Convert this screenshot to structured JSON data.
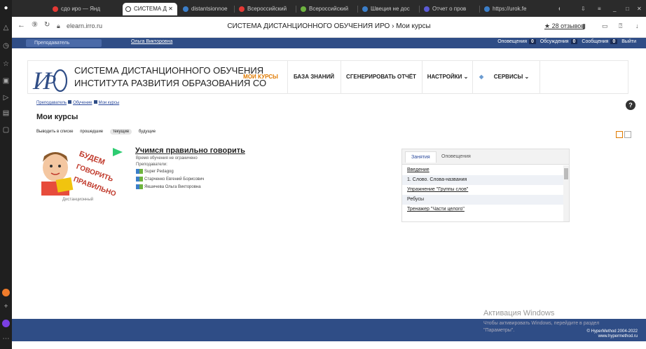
{
  "browser": {
    "tabs": [
      {
        "label": "сдо иро — Янд",
        "color": "#e53935"
      },
      {
        "label": "СИСТЕМА Д",
        "color": "#ffffff",
        "active": true
      },
      {
        "label": "distantsionnoe",
        "color": "#3b7ec9"
      },
      {
        "label": "Всероссийский",
        "color": "#e53935"
      },
      {
        "label": "Всероссийский",
        "color": "#6db33f"
      },
      {
        "label": "Швеция не дос",
        "color": "#3b7ec9"
      },
      {
        "label": "Отчет о пров",
        "color": "#5b5bd6"
      },
      {
        "label": "https://urok.fe",
        "color": "#3b7ec9"
      }
    ],
    "url": "elearn.irro.ru",
    "page_title": "СИСТЕМА ДИСТАНЦИОННОГО ОБУЧЕНИЯ ИРО › Мои курсы",
    "reviews": "★ 28 отзывов"
  },
  "topbar": {
    "role": "Преподаватель",
    "user": "Ольга Викторовна",
    "items": [
      {
        "label": "Оповещения",
        "count": "0"
      },
      {
        "label": "Обсуждения",
        "count": "0"
      },
      {
        "label": "Сообщения",
        "count": "0"
      }
    ],
    "exit": "Выйти"
  },
  "header": {
    "logo_line1": "СИСТЕМА ДИСТАНЦИОННОГО ОБУЧЕНИЯ",
    "logo_line2": "ИНСТИТУТА РАЗВИТИЯ ОБРАЗОВАНИЯ СО",
    "nav": [
      "МОИ КУРСЫ",
      "БАЗА ЗНАНИЙ",
      "СГЕНЕРИРОВАТЬ ОТЧЁТ",
      "НАСТРОЙКИ ⌄",
      "СЕРВИСЫ ⌄"
    ]
  },
  "breadcrumb": [
    "Преподаватель",
    "Обучение",
    "Мои курсы"
  ],
  "page_title": "Мои курсы",
  "filters": {
    "list": "Выводить в списке",
    "past": "прошедшие",
    "current": "текущие",
    "future": "будущие"
  },
  "course": {
    "title": "Учимся правильно говорить",
    "time": "Время обучения не ограничено",
    "teachers_label": "Преподаватели:",
    "teachers": [
      "Super Pedagog",
      "Старченко Евгений Борисович",
      "Якшичева Ольга Викторовна"
    ],
    "type": "Дистанционный",
    "image_text": "БУДЕМ ГОВОРИТЬ ПРАВИЛЬНО"
  },
  "panel": {
    "tabs": [
      "Занятия",
      "Оповещения"
    ],
    "items": [
      "Введение",
      "1. Слово. Слова-названия",
      "Упражнение \"Группы слов\"",
      "Ребусы",
      "Тренажер \"Части целого\""
    ]
  },
  "footer": {
    "copyright": "© HyperMethod 2004-2022",
    "site": "www.hypermethod.ru"
  },
  "windows": {
    "activation": "Активация Windows",
    "hint1": "Чтобы активировать Windows, перейдите в раздел",
    "hint2": "\"Параметры\"."
  }
}
